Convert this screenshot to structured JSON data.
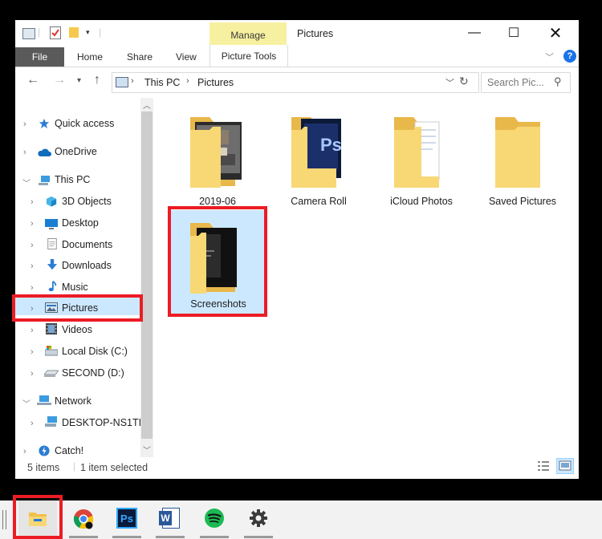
{
  "window": {
    "title": "Pictures",
    "manage_tab": "Manage",
    "ribbon_tabs": [
      "File",
      "Home",
      "Share",
      "View",
      "Picture Tools"
    ],
    "help": "?"
  },
  "address": {
    "crumbs": [
      "This PC",
      "Pictures"
    ],
    "search_placeholder": "Search Pic..."
  },
  "sidebar": {
    "items": [
      {
        "label": "Quick access",
        "icon": "star-icon"
      },
      {
        "label": "OneDrive",
        "icon": "cloud-icon"
      },
      {
        "label": "This PC",
        "icon": "computer-icon"
      },
      {
        "label": "3D Objects",
        "icon": "cube-icon"
      },
      {
        "label": "Desktop",
        "icon": "desktop-icon"
      },
      {
        "label": "Documents",
        "icon": "document-icon"
      },
      {
        "label": "Downloads",
        "icon": "download-icon"
      },
      {
        "label": "Music",
        "icon": "music-icon"
      },
      {
        "label": "Pictures",
        "icon": "pictures-icon"
      },
      {
        "label": "Videos",
        "icon": "video-icon"
      },
      {
        "label": "Local Disk (C:)",
        "icon": "disk-icon"
      },
      {
        "label": "SECOND (D:)",
        "icon": "drive-icon"
      },
      {
        "label": "Network",
        "icon": "network-icon"
      },
      {
        "label": "DESKTOP-NS1TI",
        "icon": "pc-icon"
      },
      {
        "label": "Catch!",
        "icon": "catch-icon"
      }
    ]
  },
  "folders": [
    {
      "label": "2019-06"
    },
    {
      "label": "Camera Roll",
      "badge": "Ps"
    },
    {
      "label": "iCloud Photos"
    },
    {
      "label": "Saved Pictures"
    },
    {
      "label": "Screenshots"
    }
  ],
  "status": {
    "items_count": "5 items",
    "selected": "1 item selected"
  },
  "taskbar": {
    "apps": [
      "file-explorer-icon",
      "chrome-icon",
      "photoshop-icon",
      "word-icon",
      "spotify-icon",
      "settings-icon"
    ],
    "ps_label": "Ps",
    "word_label": "W"
  },
  "colors": {
    "highlight": "#ec1c24",
    "selection": "#cce8ff",
    "folder": "#f8d775",
    "manage": "#f7f0a0"
  }
}
